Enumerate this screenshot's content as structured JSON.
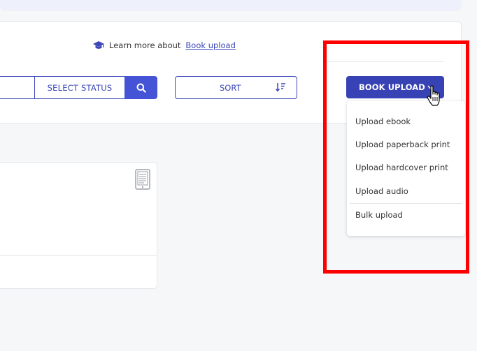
{
  "learn_more": {
    "prefix": "Learn more about",
    "link_text": "Book upload"
  },
  "toolbar": {
    "select_status_label": "SELECT STATUS",
    "sort_label": "SORT",
    "book_upload_label": "BOOK UPLOAD"
  },
  "dropdown": {
    "items": [
      {
        "label": "Upload ebook"
      },
      {
        "label": "Upload paperback print"
      },
      {
        "label": "Upload hardcover print"
      },
      {
        "label": "Upload audio"
      },
      {
        "label": "Bulk upload"
      }
    ]
  },
  "colors": {
    "primary": "#3742b4",
    "search_button": "#4553d6",
    "highlight": "#ff0000",
    "background": "#f6f7f9"
  },
  "icons": {
    "learn_more": "graduation-cap-icon",
    "search": "search-icon",
    "sort": "sort-descending-icon",
    "book_upload": "chevron-down-icon",
    "card": "ebook-reader-icon",
    "pointer": "hand-cursor-icon"
  }
}
